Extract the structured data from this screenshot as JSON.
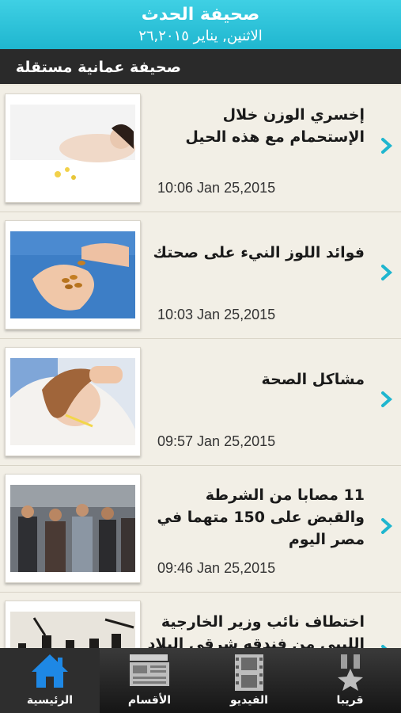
{
  "header": {
    "title": "صحيفة الحدث",
    "date": "الاثنين, يناير ٢٦,٢٠١٥"
  },
  "subheader": "صحيفة عمانية مستقلة",
  "articles": [
    {
      "headline": "إخسري الوزن خلال الإستحمام مع هذه الحيل",
      "time": "10:06 Jan 25,2015"
    },
    {
      "headline": "فوائد اللوز النيء على صحتك",
      "time": "10:03 Jan 25,2015"
    },
    {
      "headline": "مشاكل الصحة",
      "time": "09:57 Jan 25,2015"
    },
    {
      "headline": "11 مصابا من الشرطة والقبض على 150 متهما في مصر اليوم",
      "time": "09:46 Jan 25,2015"
    },
    {
      "headline": "اختطاف نائب وزير الخارجية الليبي من فندقه شرقي البلاد",
      "time": ""
    }
  ],
  "tabs": [
    {
      "label": "الرئيسية",
      "icon": "home-icon",
      "active": true
    },
    {
      "label": "الأقسام",
      "icon": "sections-icon",
      "active": false
    },
    {
      "label": "الفيديو",
      "icon": "film-icon",
      "active": false
    },
    {
      "label": "قريبا",
      "icon": "star-medal-icon",
      "active": false
    }
  ],
  "colors": {
    "header": "#1fb6cf",
    "accent": "#1fb6cf",
    "tabbar": "#1a1a1a",
    "active_tab_icon": "#1e88e5"
  }
}
